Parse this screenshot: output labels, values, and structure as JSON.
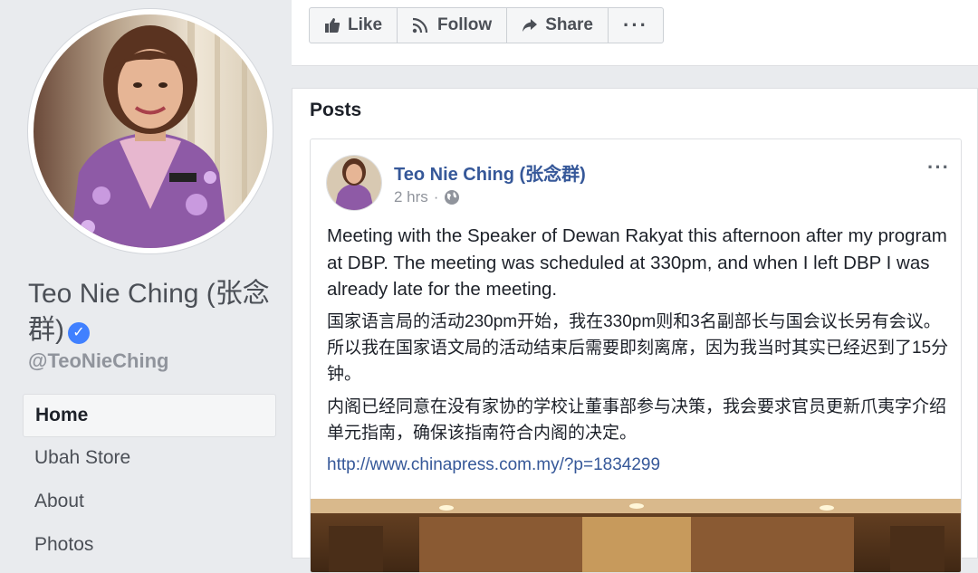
{
  "profile": {
    "name": "Teo Nie Ching (张念群)",
    "handle": "@TeoNieChing"
  },
  "nav": {
    "items": [
      {
        "label": "Home",
        "active": true
      },
      {
        "label": "Ubah Store",
        "active": false
      },
      {
        "label": "About",
        "active": false
      },
      {
        "label": "Photos",
        "active": false
      }
    ]
  },
  "actions": {
    "like_label": "Like",
    "follow_label": "Follow",
    "share_label": "Share",
    "more_label": "···"
  },
  "posts": {
    "title": "Posts",
    "post": {
      "author": "Teo Nie Ching (张念群)",
      "time": "2 hrs",
      "menu": "···",
      "text_en": "Meeting with the Speaker of Dewan Rakyat this afternoon after my program at DBP. The meeting was scheduled at 330pm, and when I left DBP I was already late for the meeting.",
      "text_cn_1": "国家语言局的活动230pm开始，我在330pm则和3名副部长与国会议长另有会议。所以我在国家语文局的活动结束后需要即刻离席，因为我当时其实已经迟到了15分钟。",
      "text_cn_2": "内阁已经同意在没有家协的学校让董事部参与决策，我会要求官员更新爪夷字介绍单元指南，确保该指南符合内阁的决定。",
      "link": "http://www.chinapress.com.my/?p=1834299"
    }
  },
  "colors": {
    "background": "#e9ebee",
    "link": "#365899",
    "verified": "#4080ff"
  }
}
